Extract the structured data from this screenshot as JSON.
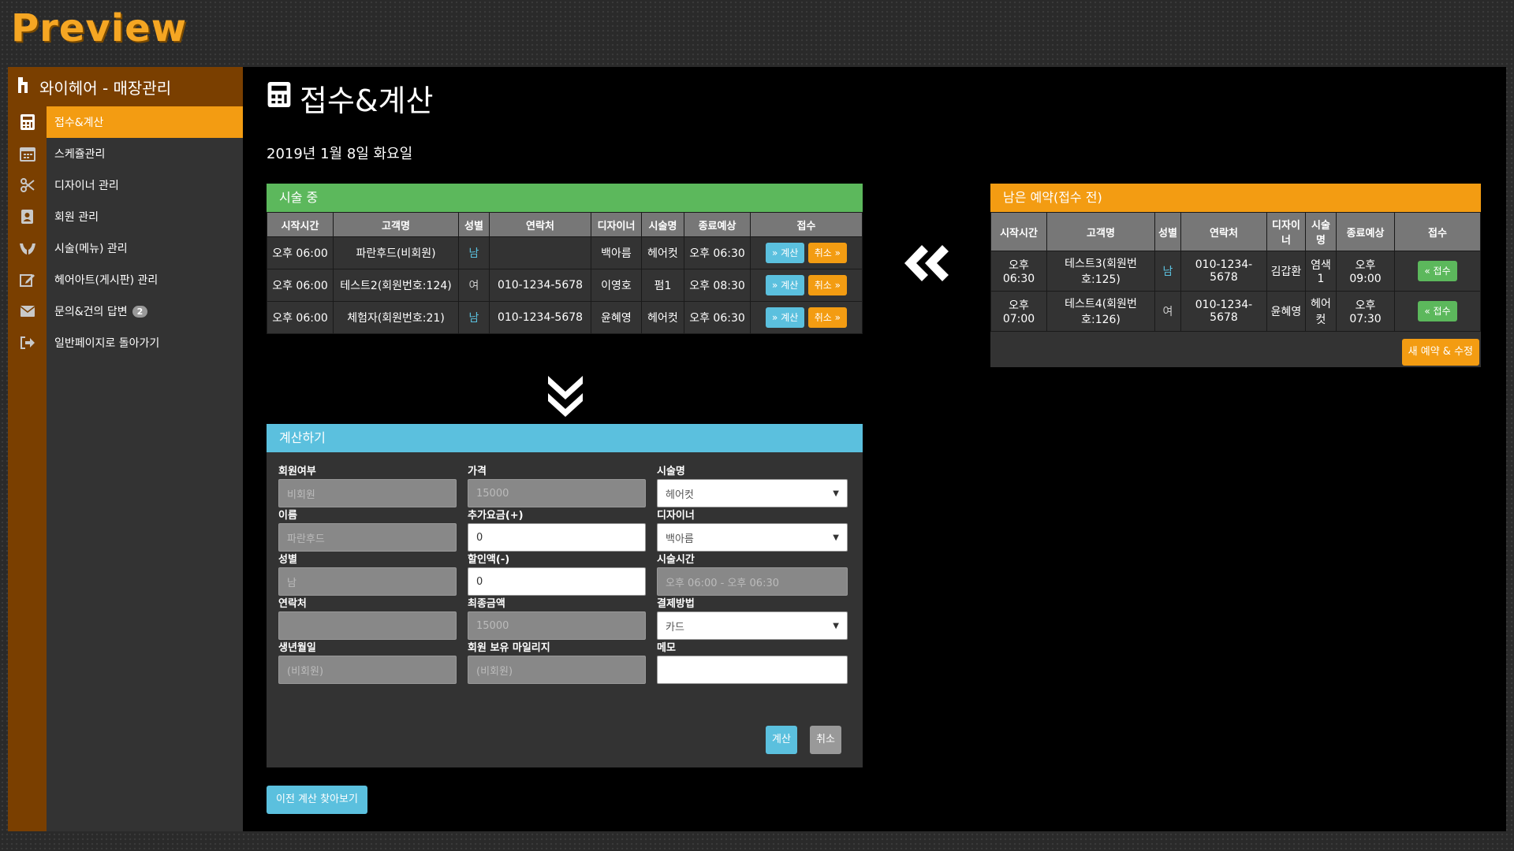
{
  "preview_title": "Preview",
  "app": {
    "title": "와이헤어 - 매장관리"
  },
  "sidebar": {
    "items": [
      {
        "label": "접수&계산",
        "icon": "calculator-icon"
      },
      {
        "label": "스케쥴관리",
        "icon": "calendar-icon"
      },
      {
        "label": "디자이너 관리",
        "icon": "scissors-icon"
      },
      {
        "label": "회원 관리",
        "icon": "address-book-icon"
      },
      {
        "label": "시술(메뉴) 관리",
        "icon": "hands-icon"
      },
      {
        "label": "헤어아트(게시판) 관리",
        "icon": "edit-icon"
      },
      {
        "label": "문의&건의 답변",
        "icon": "envelope-icon",
        "badge": "2"
      },
      {
        "label": "일반페이지로 돌아가기",
        "icon": "sign-out-icon"
      }
    ]
  },
  "page": {
    "title": "접수&계산",
    "date": "2019년 1월 8일 화요일"
  },
  "in_progress": {
    "header": "시술 중",
    "columns": [
      "시작시간",
      "고객명",
      "성별",
      "연락처",
      "디자이너",
      "시술명",
      "종료예상",
      "접수"
    ],
    "rows": [
      {
        "start": "오후 06:00",
        "name": "파란후드(비회원)",
        "gender": "남",
        "phone": "",
        "designer": "백아름",
        "service": "헤어컷",
        "end": "오후 06:30"
      },
      {
        "start": "오후 06:00",
        "name": "테스트2(회원번호:124)",
        "gender": "여",
        "phone": "010-1234-5678",
        "designer": "이영호",
        "service": "펌1",
        "end": "오후 08:30"
      },
      {
        "start": "오후 06:00",
        "name": "체험자(회원번호:21)",
        "gender": "남",
        "phone": "010-1234-5678",
        "designer": "윤혜영",
        "service": "헤어컷",
        "end": "오후 06:30"
      }
    ],
    "calc_label": "계산",
    "cancel_label": "취소"
  },
  "pending": {
    "header": "남은 예약(접수 전)",
    "columns": [
      "시작시간",
      "고객명",
      "성별",
      "연락처",
      "디자이너",
      "시술명",
      "종료예상",
      "접수"
    ],
    "rows": [
      {
        "start": "오후 06:30",
        "name": "테스트3(회원번호:125)",
        "gender": "남",
        "phone": "010-1234-5678",
        "designer": "김갑환",
        "service": "염색1",
        "end": "오후 09:00"
      },
      {
        "start": "오후 07:00",
        "name": "테스트4(회원번호:126)",
        "gender": "여",
        "phone": "010-1234-5678",
        "designer": "윤혜영",
        "service": "헤어컷",
        "end": "오후 07:30"
      }
    ],
    "accept_label": "접수",
    "new_button": "새 예약 & 수정"
  },
  "calc_form": {
    "header": "계산하기",
    "member_label": "회원여부",
    "member_value": "비회원",
    "price_label": "가격",
    "price_value": "15000",
    "service_label": "시술명",
    "service_value": "헤어컷",
    "name_label": "이름",
    "name_value": "파란후드",
    "extra_label": "추가요금(+)",
    "extra_value": "0",
    "designer_label": "디자이너",
    "designer_value": "백아름",
    "gender_label": "성별",
    "gender_value": "남",
    "discount_label": "할인액(-)",
    "discount_value": "0",
    "time_label": "시술시간",
    "time_value": "오후 06:00 - 오후 06:30",
    "phone_label": "연락처",
    "phone_value": "",
    "final_label": "최종금액",
    "final_value": "15000",
    "payment_label": "결제방법",
    "payment_value": "카드",
    "birth_label": "생년월일",
    "birth_value": "(비회원)",
    "mileage_label": "회원 보유 마일리지",
    "mileage_value": "(비회원)",
    "memo_label": "메모",
    "memo_value": "",
    "submit_label": "계산",
    "cancel_label": "취소"
  },
  "history_button": "이전 계산 찾아보기",
  "colors": {
    "accent": "#f39c12",
    "success": "#5cb85c",
    "info": "#5bc0de",
    "brand_dark": "#7a3f00"
  }
}
